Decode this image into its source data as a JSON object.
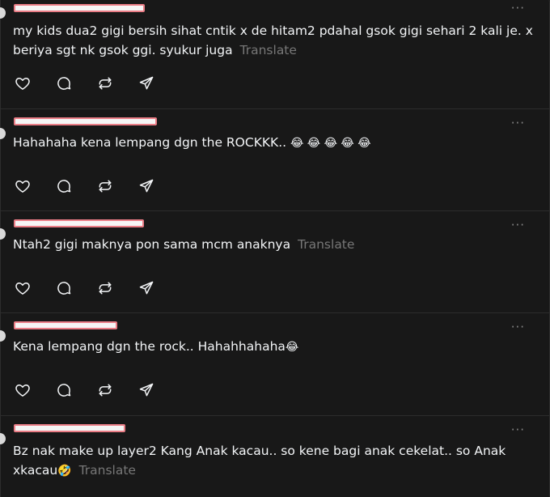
{
  "thread": {
    "posts": [
      {
        "text": "my kids dua2 gigi bersih sihat cntik x de hitam2 pdahal gsok gigi sehari 2 kali je. x beriya sgt nk gsok ggi. syukur juga",
        "translate": "Translate"
      },
      {
        "text": "Hahahaha kena lempang dgn the ROCKKK..",
        "emoji": "😂 😂 😂 😂 😂",
        "translate": ""
      },
      {
        "text": "Ntah2 gigi maknya pon sama mcm anaknya",
        "translate": "Translate"
      },
      {
        "text": "Kena lempang dgn the rock.. Hahahhahaha",
        "emoji": "😂",
        "translate": ""
      },
      {
        "text": "Bz nak make up layer2 Kang Anak kacau.. so kene bagi anak cekelat.. so Anak xkacau",
        "emoji": "🤣",
        "translate": "Translate"
      }
    ],
    "more_label": "···",
    "action_icons": [
      "heart-icon",
      "comment-icon",
      "repost-icon",
      "share-icon"
    ]
  }
}
